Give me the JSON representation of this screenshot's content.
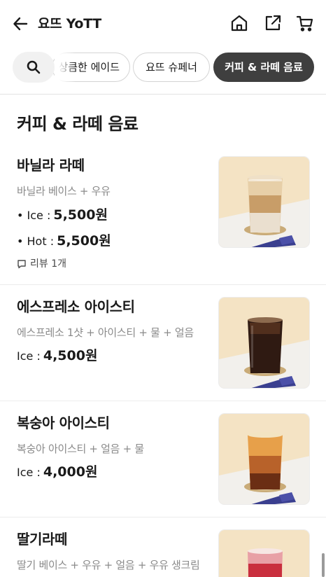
{
  "header": {
    "title": "요뜨 YoTT",
    "icons": [
      "back-arrow-icon",
      "home-icon",
      "share-icon",
      "cart-icon"
    ]
  },
  "categories": {
    "search_icon": "search-icon",
    "chips": [
      {
        "label": "상큼한 에이드",
        "active": false
      },
      {
        "label": "요뜨 슈페너",
        "active": false
      },
      {
        "label": "커피 & 라떼 음료",
        "active": true
      }
    ]
  },
  "section": {
    "title": "커피 & 라떼 음료"
  },
  "menu": [
    {
      "name": "바닐라 라떼",
      "desc": "바닐라 베이스 + 우유",
      "prices": [
        {
          "label": "• Ice :",
          "amount": "5,500원"
        },
        {
          "label": "• Hot :",
          "amount": "5,500원"
        }
      ],
      "review": "리뷰 1개"
    },
    {
      "name": "에스프레소 아이스티",
      "desc": "에스프레소 1샷 + 아이스티 + 물 + 얼음",
      "prices": [
        {
          "label": "Ice :",
          "amount": "4,500원"
        }
      ]
    },
    {
      "name": "복숭아 아이스티",
      "desc": "복숭아 아이스티 + 얼음 + 물",
      "prices": [
        {
          "label": "Ice :",
          "amount": "4,000원"
        }
      ]
    },
    {
      "name": "딸기라떼",
      "desc": "딸기 베이스 + 우유 + 얼음 + 우유 생크림",
      "prices": []
    }
  ],
  "colors": {
    "active_chip": "#3f3f3f",
    "muted_text": "#8a8a8a",
    "divider": "#e3e3e3"
  }
}
